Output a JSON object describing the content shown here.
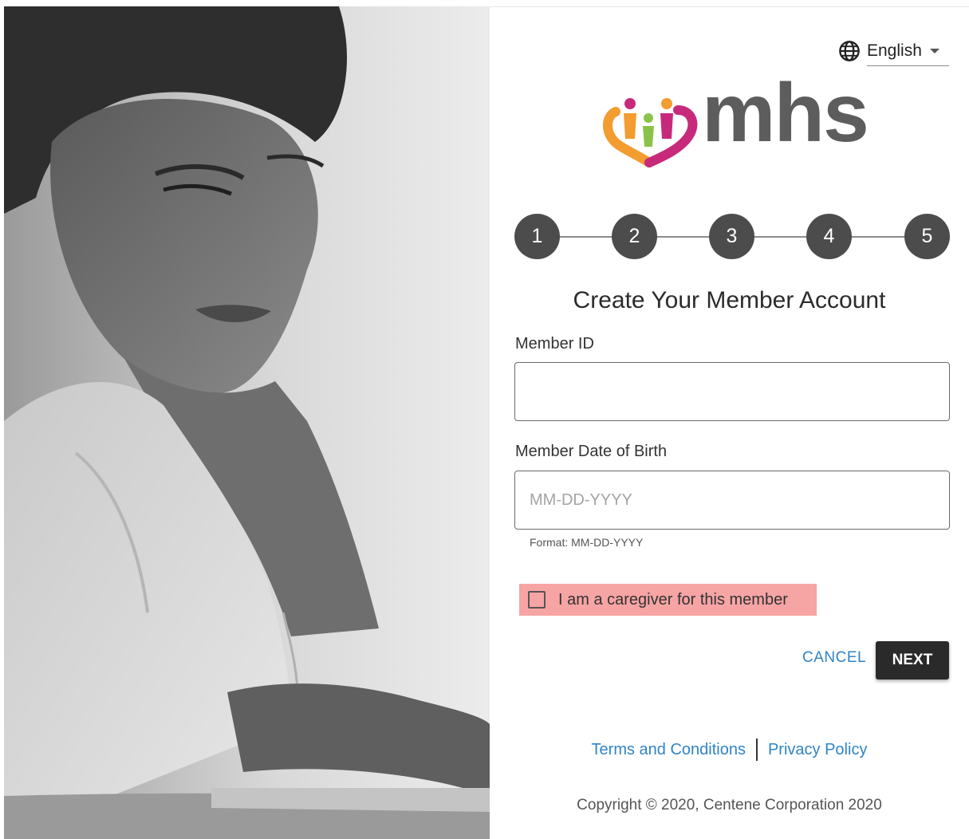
{
  "language": {
    "icon": "globe-icon",
    "selected": "English"
  },
  "logo": {
    "text": "mhs",
    "colors": {
      "orange": "#f39c2f",
      "magenta": "#c72a7b",
      "green": "#8bc34a",
      "gray": "#5d5d5d"
    }
  },
  "stepper": {
    "steps": [
      "1",
      "2",
      "3",
      "4",
      "5"
    ]
  },
  "form": {
    "title": "Create Your Member Account",
    "member_id_label": "Member ID",
    "member_id_value": "",
    "dob_label": "Member Date of Birth",
    "dob_placeholder": "MM-DD-YYYY",
    "dob_hint": "Format: MM-DD-YYYY",
    "caregiver_label": "I am a caregiver for this member",
    "caregiver_checked": false,
    "cancel_label": "CANCEL",
    "next_label": "NEXT"
  },
  "footer": {
    "terms_label": "Terms and Conditions",
    "privacy_label": "Privacy Policy",
    "copyright": "Copyright © 2020, Centene Corporation 2020"
  },
  "colors": {
    "link": "#2f84c7",
    "highlight": "#f7a4a4",
    "button_dark": "#2a2a2a",
    "step_circle": "#4c4c4c"
  }
}
